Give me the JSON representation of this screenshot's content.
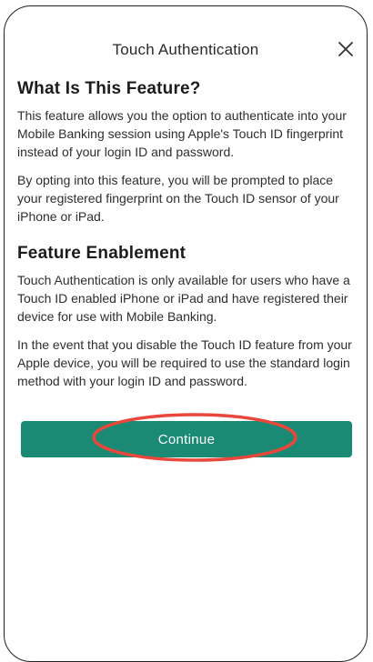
{
  "header": {
    "title": "Touch Authentication",
    "close_icon": "close-icon"
  },
  "sections": [
    {
      "heading": "What Is This Feature?",
      "paragraphs": [
        "This feature allows you the option to authenticate into your Mobile Banking session using Apple's Touch ID fingerprint instead of your login ID and password.",
        "By opting into this feature, you will be prompted to place your registered fingerprint on the Touch ID sensor of your iPhone or iPad."
      ]
    },
    {
      "heading": "Feature Enablement",
      "paragraphs": [
        "Touch Authentication is only available for users who have a Touch ID enabled iPhone or iPad and have registered their device for use with Mobile Banking.",
        "In the event that you disable the Touch ID feature from your Apple device, you will be required to use the standard login method with your login ID and password."
      ]
    }
  ],
  "actions": {
    "continue_label": "Continue"
  },
  "colors": {
    "accent": "#1a8a74",
    "highlight": "#e8473c"
  }
}
